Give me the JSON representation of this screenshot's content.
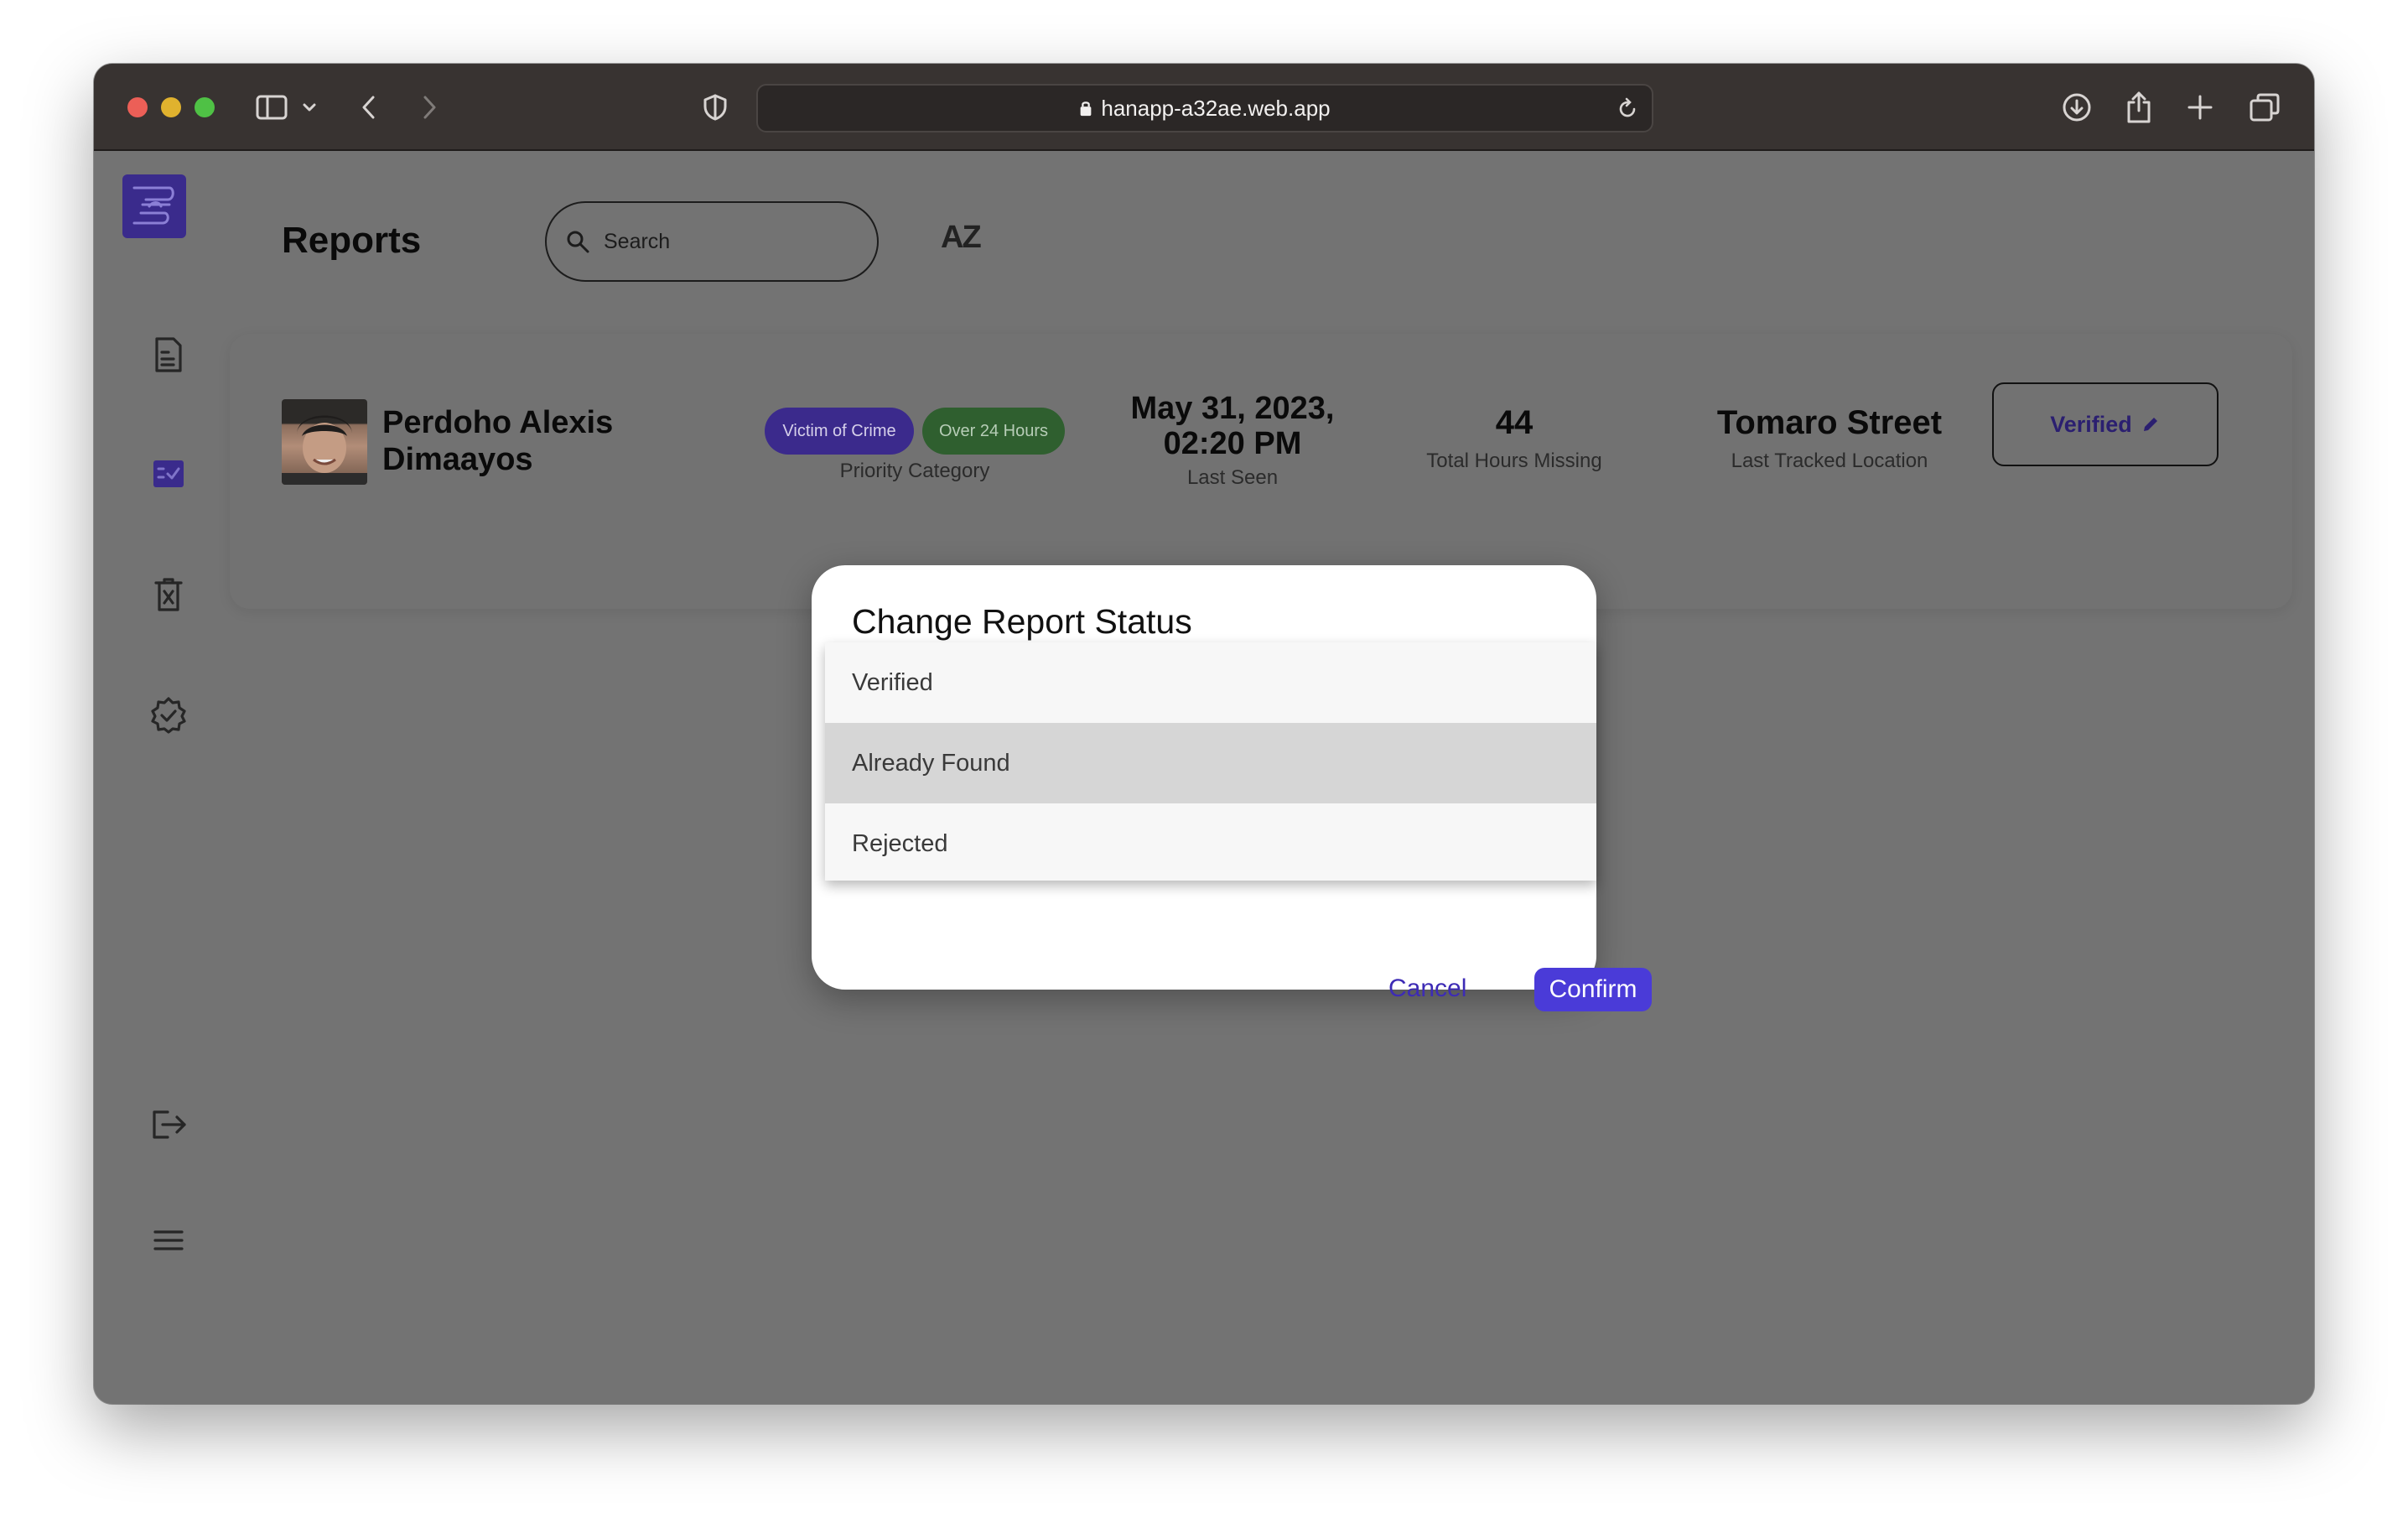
{
  "browser": {
    "url": "hanapp-a32ae.web.app"
  },
  "header": {
    "title": "Reports",
    "search_placeholder": "Search",
    "sort_label": "AZ"
  },
  "report": {
    "name_line1": "Perdoho Alexis",
    "name_line2": "Dimaayos",
    "badges": [
      "Victim of Crime",
      "Over 24 Hours"
    ],
    "priority_label": "Priority Category",
    "last_seen_date": "May 31, 2023,",
    "last_seen_time": "02:20 PM",
    "last_seen_label": "Last Seen",
    "hours_missing": "44",
    "hours_missing_label": "Total Hours Missing",
    "location": "Tomaro Street",
    "location_label": "Last Tracked Location",
    "status": "Verified"
  },
  "dialog": {
    "title": "Change Report Status",
    "options": [
      "Verified",
      "Already Found",
      "Rejected"
    ],
    "highlighted_option": "Already Found",
    "cancel_label": "Cancel",
    "confirm_label": "Confirm"
  },
  "colors": {
    "accent": "#4a3bd8",
    "badge_crime": "#3b2a8c",
    "badge_hours": "#2f5f2f"
  }
}
